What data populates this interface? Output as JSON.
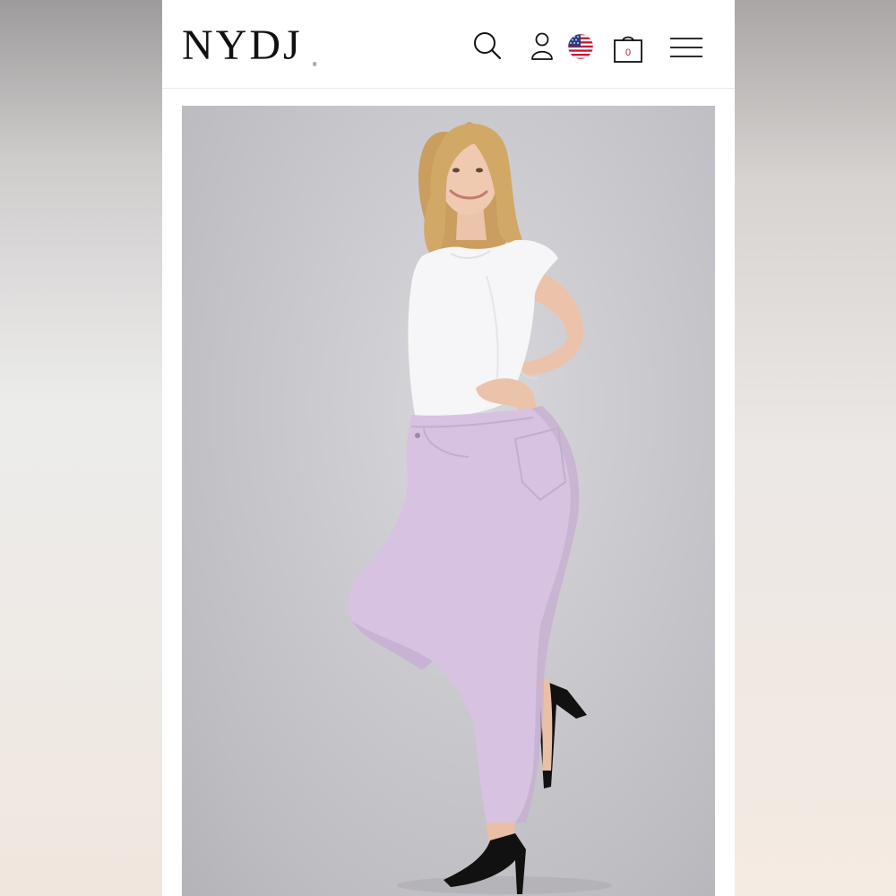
{
  "background": {
    "side_left_color": "#c9c7c6",
    "side_right_color": "#e6ddd6"
  },
  "header": {
    "logo_text": "NYDJ",
    "logo_mark": "®",
    "icons": [
      "search-icon",
      "account-icon",
      "us-flag-icon",
      "shopping-bag-icon",
      "menu-icon"
    ],
    "bag_count": "0"
  },
  "hero": {
    "image": "model-in-lilac-jeans",
    "colors": {
      "backdrop": "#c6c5ca",
      "top": "#f6f5f7",
      "jeans": "#d7c2e1",
      "hair": "#c99e5e"
    }
  }
}
